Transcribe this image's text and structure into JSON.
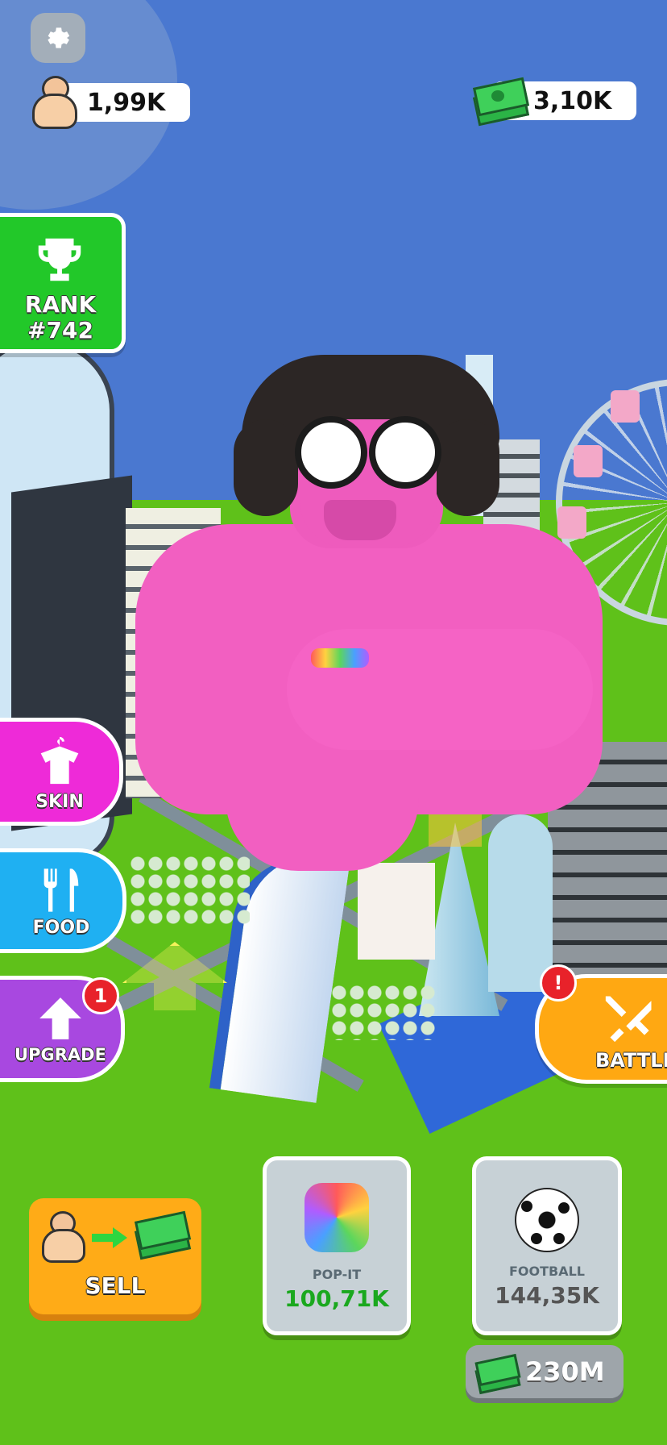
{
  "settings": {
    "icon": "gear-icon"
  },
  "strength": {
    "value": "1,99K",
    "icon": "muscle-man-icon"
  },
  "money": {
    "value": "3,10K",
    "icon": "cash-stack-icon"
  },
  "rank": {
    "label": "RANK",
    "value": "#742",
    "icon": "trophy-icon",
    "color": "#22c829"
  },
  "side_buttons": {
    "skin": {
      "label": "SKIN",
      "icon": "shirt-hanger-icon",
      "color": "#ee2ad8"
    },
    "food": {
      "label": "FOOD",
      "icon": "fork-knife-icon",
      "color": "#1fb0f2"
    },
    "upgrade": {
      "label": "UPGRADE",
      "icon": "up-arrow-icon",
      "color": "#a848e0",
      "badge": "1"
    }
  },
  "battle": {
    "label": "BATTLE",
    "icon": "crossed-swords-icon",
    "color": "#ffa812",
    "badge": "!"
  },
  "sell": {
    "label": "SELL",
    "icon": "strength-to-cash-icon",
    "color": "#ffab17"
  },
  "cards": [
    {
      "name": "POP-IT",
      "value": "100,71K",
      "icon": "pop-it-icon",
      "value_color": "#1aa81e"
    },
    {
      "name": "FOOTBALL",
      "value": "144,35K",
      "icon": "football-icon",
      "value_color": "#555555"
    }
  ],
  "price": {
    "value": "230M",
    "icon": "cash-stack-icon"
  }
}
